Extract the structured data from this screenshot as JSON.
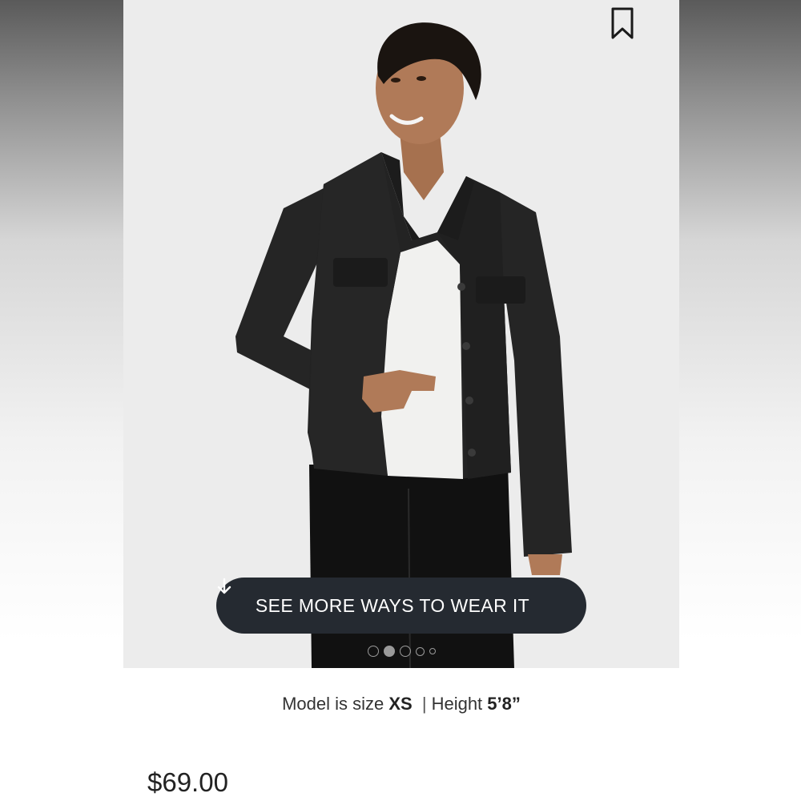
{
  "header": {
    "bookmark_icon": "bookmark-icon"
  },
  "gallery": {
    "wear_it_label": "SEE MORE WAYS TO WEAR IT",
    "wear_it_icon": "arrow-down-icon",
    "dots_total": 5,
    "active_dot": 2
  },
  "model_info": {
    "size_prefix": "Model is size",
    "size_value": "XS",
    "separator": "|",
    "height_prefix": "Height",
    "height_value": "5’8”"
  },
  "product": {
    "price": "$69.00"
  },
  "colors": {
    "button_bg": "#252a31",
    "button_text": "#ffffff",
    "photo_bg": "#ececec",
    "jacket": "#232323"
  }
}
